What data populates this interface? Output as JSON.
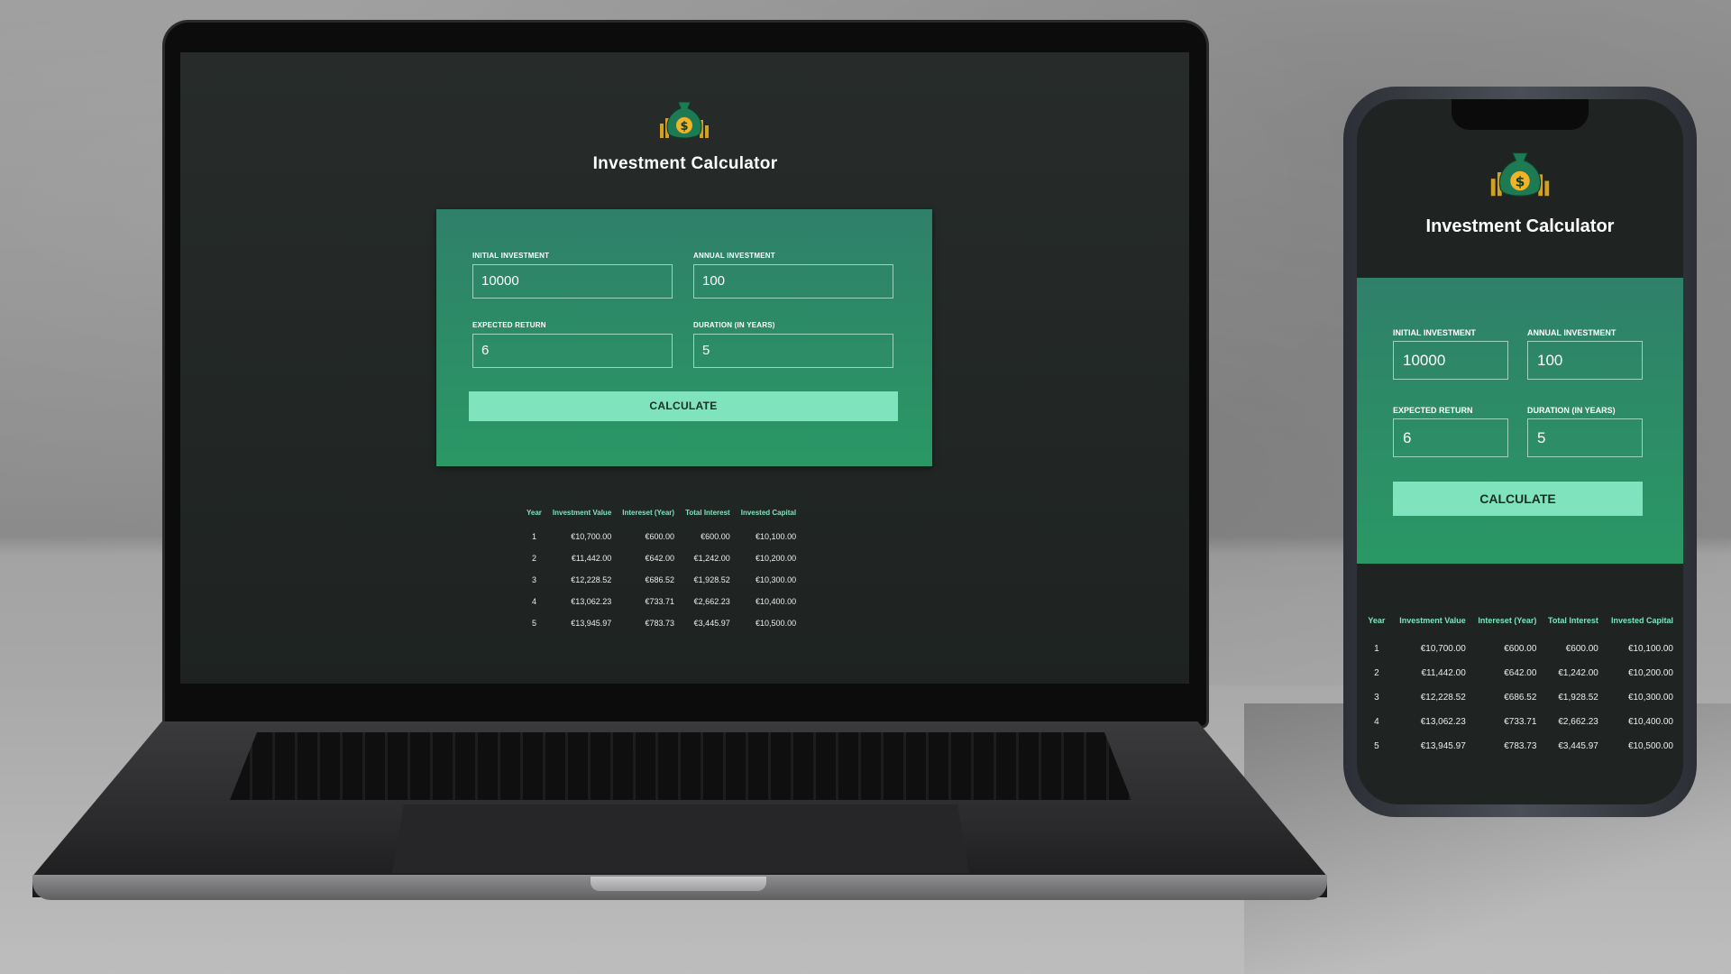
{
  "app": {
    "title": "Investment Calculator",
    "logo_icon": "money-bag-icon",
    "colors": {
      "background": "#242927",
      "card": "#2c8c68",
      "accent": "#7fe4bd",
      "header_text": "#7fe4bd"
    }
  },
  "form": {
    "initial_investment": {
      "label": "INITIAL INVESTMENT",
      "value": "10000"
    },
    "annual_investment": {
      "label": "ANNUAL INVESTMENT",
      "value": "100"
    },
    "expected_return": {
      "label": "EXPECTED RETURN",
      "value": "6"
    },
    "duration": {
      "label": "DURATION (IN YEARS)",
      "value": "5"
    },
    "calculate_label": "CALCULATE"
  },
  "table": {
    "headers": {
      "year": "Year",
      "investment_value": "Investment Value",
      "interest_year": "Intereset (Year)",
      "total_interest": "Total Interest",
      "invested_capital": "Invested Capital"
    },
    "rows": [
      {
        "year": "1",
        "investment_value": "€10,700.00",
        "interest_year": "€600.00",
        "total_interest": "€600.00",
        "invested_capital": "€10,100.00"
      },
      {
        "year": "2",
        "investment_value": "€11,442.00",
        "interest_year": "€642.00",
        "total_interest": "€1,242.00",
        "invested_capital": "€10,200.00"
      },
      {
        "year": "3",
        "investment_value": "€12,228.52",
        "interest_year": "€686.52",
        "total_interest": "€1,928.52",
        "invested_capital": "€10,300.00"
      },
      {
        "year": "4",
        "investment_value": "€13,062.23",
        "interest_year": "€733.71",
        "total_interest": "€2,662.23",
        "invested_capital": "€10,400.00"
      },
      {
        "year": "5",
        "investment_value": "€13,945.97",
        "interest_year": "€783.73",
        "total_interest": "€3,445.97",
        "invested_capital": "€10,500.00"
      }
    ]
  },
  "phone_table": {
    "rows": [
      {
        "year": "1",
        "investment_value": "€10,700.00",
        "interest_year": "€600.00",
        "total_interest": "€600.00",
        "invested_capital": "€10,100.00"
      },
      {
        "year": "2",
        "investment_value": "€11,442.00",
        "interest_year": "€642.00",
        "total_interest": "€1,242.00",
        "invested_capital": "€10,200.00"
      },
      {
        "year": "3",
        "investment_value": "€12,228.52",
        "interest_year": "€686.52",
        "total_interest": "€1,928.52",
        "invested_capital": "€10,300.00"
      },
      {
        "year": "4",
        "investment_value": "€13,062.23",
        "interest_year": "€733.71",
        "total_interest": "€2,662.23",
        "invested_capital": "€10,400.00"
      },
      {
        "year": "5",
        "investment_value": "€13,945.97",
        "interest_year": "€783.73",
        "total_interest": "€3,445.97",
        "invested_capital": "€10,500.00"
      }
    ]
  }
}
